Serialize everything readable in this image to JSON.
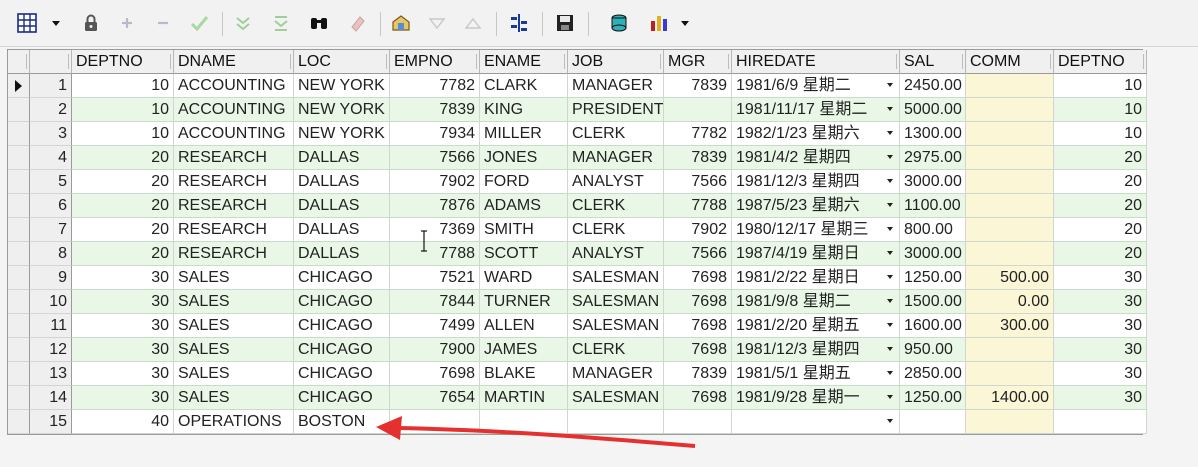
{
  "toolbar": {
    "icons": [
      "grid-options-icon",
      "lock-icon",
      "add-record-icon",
      "delete-record-icon",
      "post-edit-icon",
      "filter-icon",
      "clear-filter-icon",
      "find-icon",
      "eraser-icon",
      "query-icon",
      "sort-desc-icon",
      "sort-asc-icon",
      "tree-icon",
      "save-icon",
      "database-icon",
      "chart-icon"
    ]
  },
  "grid": {
    "columns": [
      {
        "key": "DEPTNO",
        "label": "DEPTNO"
      },
      {
        "key": "DNAME",
        "label": "DNAME"
      },
      {
        "key": "LOC",
        "label": "LOC"
      },
      {
        "key": "EMPNO",
        "label": "EMPNO"
      },
      {
        "key": "ENAME",
        "label": "ENAME"
      },
      {
        "key": "JOB",
        "label": "JOB"
      },
      {
        "key": "MGR",
        "label": "MGR"
      },
      {
        "key": "HIREDATE",
        "label": "HIREDATE"
      },
      {
        "key": "SAL",
        "label": "SAL"
      },
      {
        "key": "COMM",
        "label": "COMM"
      },
      {
        "key": "DEPTNO2",
        "label": "DEPTNO"
      }
    ],
    "rows": [
      {
        "n": "1",
        "DEPTNO": "10",
        "DNAME": "ACCOUNTING",
        "LOC": "NEW YORK",
        "EMPNO": "7782",
        "ENAME": "CLARK",
        "JOB": "MANAGER",
        "MGR": "7839",
        "HIREDATE": "1981/6/9 星期二",
        "SAL": "2450.00",
        "COMM": "",
        "DEPTNO2": "10"
      },
      {
        "n": "2",
        "DEPTNO": "10",
        "DNAME": "ACCOUNTING",
        "LOC": "NEW YORK",
        "EMPNO": "7839",
        "ENAME": "KING",
        "JOB": "PRESIDENT",
        "MGR": "",
        "HIREDATE": "1981/11/17 星期二",
        "SAL": "5000.00",
        "COMM": "",
        "DEPTNO2": "10"
      },
      {
        "n": "3",
        "DEPTNO": "10",
        "DNAME": "ACCOUNTING",
        "LOC": "NEW YORK",
        "EMPNO": "7934",
        "ENAME": "MILLER",
        "JOB": "CLERK",
        "MGR": "7782",
        "HIREDATE": "1982/1/23 星期六",
        "SAL": "1300.00",
        "COMM": "",
        "DEPTNO2": "10"
      },
      {
        "n": "4",
        "DEPTNO": "20",
        "DNAME": "RESEARCH",
        "LOC": "DALLAS",
        "EMPNO": "7566",
        "ENAME": "JONES",
        "JOB": "MANAGER",
        "MGR": "7839",
        "HIREDATE": "1981/4/2 星期四",
        "SAL": "2975.00",
        "COMM": "",
        "DEPTNO2": "20"
      },
      {
        "n": "5",
        "DEPTNO": "20",
        "DNAME": "RESEARCH",
        "LOC": "DALLAS",
        "EMPNO": "7902",
        "ENAME": "FORD",
        "JOB": "ANALYST",
        "MGR": "7566",
        "HIREDATE": "1981/12/3 星期四",
        "SAL": "3000.00",
        "COMM": "",
        "DEPTNO2": "20"
      },
      {
        "n": "6",
        "DEPTNO": "20",
        "DNAME": "RESEARCH",
        "LOC": "DALLAS",
        "EMPNO": "7876",
        "ENAME": "ADAMS",
        "JOB": "CLERK",
        "MGR": "7788",
        "HIREDATE": "1987/5/23 星期六",
        "SAL": "1100.00",
        "COMM": "",
        "DEPTNO2": "20"
      },
      {
        "n": "7",
        "DEPTNO": "20",
        "DNAME": "RESEARCH",
        "LOC": "DALLAS",
        "EMPNO": "7369",
        "ENAME": "SMITH",
        "JOB": "CLERK",
        "MGR": "7902",
        "HIREDATE": "1980/12/17 星期三",
        "SAL": "800.00",
        "COMM": "",
        "DEPTNO2": "20"
      },
      {
        "n": "8",
        "DEPTNO": "20",
        "DNAME": "RESEARCH",
        "LOC": "DALLAS",
        "EMPNO": "7788",
        "ENAME": "SCOTT",
        "JOB": "ANALYST",
        "MGR": "7566",
        "HIREDATE": "1987/4/19 星期日",
        "SAL": "3000.00",
        "COMM": "",
        "DEPTNO2": "20"
      },
      {
        "n": "9",
        "DEPTNO": "30",
        "DNAME": "SALES",
        "LOC": "CHICAGO",
        "EMPNO": "7521",
        "ENAME": "WARD",
        "JOB": "SALESMAN",
        "MGR": "7698",
        "HIREDATE": "1981/2/22 星期日",
        "SAL": "1250.00",
        "COMM": "500.00",
        "DEPTNO2": "30"
      },
      {
        "n": "10",
        "DEPTNO": "30",
        "DNAME": "SALES",
        "LOC": "CHICAGO",
        "EMPNO": "7844",
        "ENAME": "TURNER",
        "JOB": "SALESMAN",
        "MGR": "7698",
        "HIREDATE": "1981/9/8 星期二",
        "SAL": "1500.00",
        "COMM": "0.00",
        "DEPTNO2": "30"
      },
      {
        "n": "11",
        "DEPTNO": "30",
        "DNAME": "SALES",
        "LOC": "CHICAGO",
        "EMPNO": "7499",
        "ENAME": "ALLEN",
        "JOB": "SALESMAN",
        "MGR": "7698",
        "HIREDATE": "1981/2/20 星期五",
        "SAL": "1600.00",
        "COMM": "300.00",
        "DEPTNO2": "30"
      },
      {
        "n": "12",
        "DEPTNO": "30",
        "DNAME": "SALES",
        "LOC": "CHICAGO",
        "EMPNO": "7900",
        "ENAME": "JAMES",
        "JOB": "CLERK",
        "MGR": "7698",
        "HIREDATE": "1981/12/3 星期四",
        "SAL": "950.00",
        "COMM": "",
        "DEPTNO2": "30"
      },
      {
        "n": "13",
        "DEPTNO": "30",
        "DNAME": "SALES",
        "LOC": "CHICAGO",
        "EMPNO": "7698",
        "ENAME": "BLAKE",
        "JOB": "MANAGER",
        "MGR": "7839",
        "HIREDATE": "1981/5/1 星期五",
        "SAL": "2850.00",
        "COMM": "",
        "DEPTNO2": "30"
      },
      {
        "n": "14",
        "DEPTNO": "30",
        "DNAME": "SALES",
        "LOC": "CHICAGO",
        "EMPNO": "7654",
        "ENAME": "MARTIN",
        "JOB": "SALESMAN",
        "MGR": "7698",
        "HIREDATE": "1981/9/28 星期一",
        "SAL": "1250.00",
        "COMM": "1400.00",
        "DEPTNO2": "30"
      },
      {
        "n": "15",
        "DEPTNO": "40",
        "DNAME": "OPERATIONS",
        "LOC": "BOSTON",
        "EMPNO": "",
        "ENAME": "",
        "JOB": "",
        "MGR": "",
        "HIREDATE": "",
        "SAL": "",
        "COMM": "",
        "DEPTNO2": ""
      }
    ]
  },
  "colors": {
    "row_green": "#e9f8e6",
    "comm_yellow": "#fbf6d6",
    "arrow_red": "#e53030"
  }
}
